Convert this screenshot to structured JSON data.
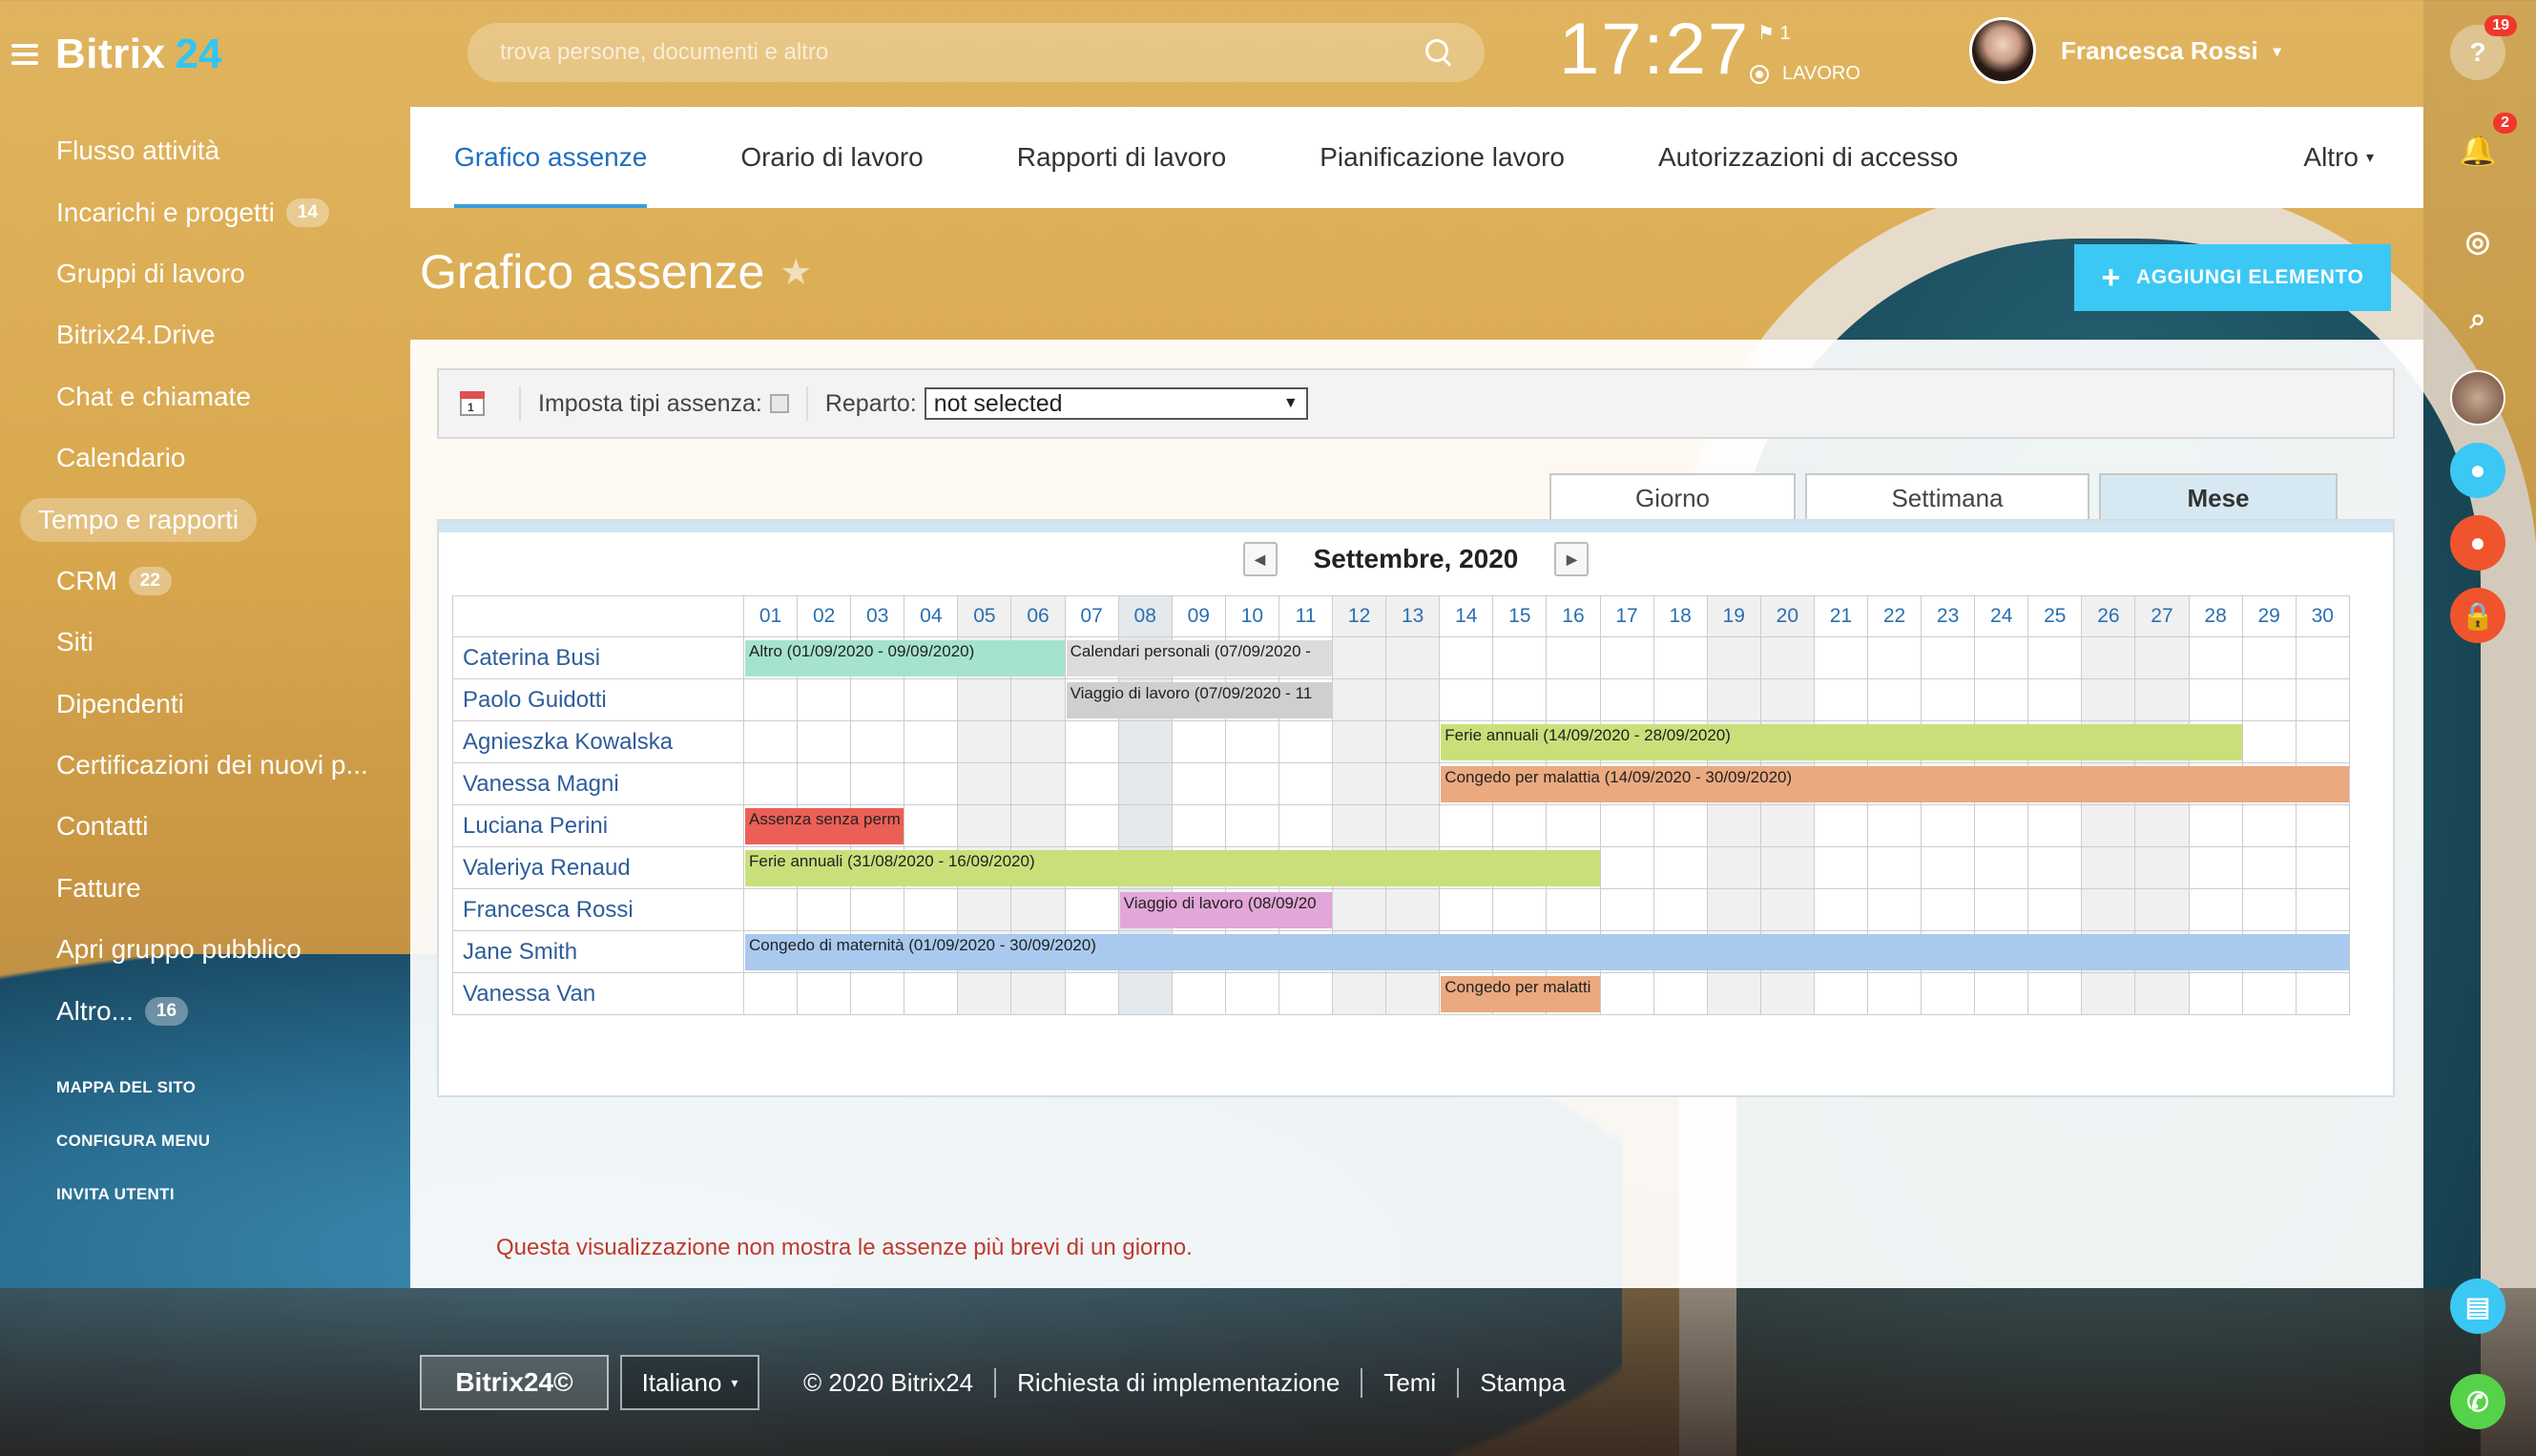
{
  "app": {
    "logo_text": "Bitrix",
    "logo_num": "24"
  },
  "search": {
    "placeholder": "trova persone, documenti e altro"
  },
  "clock": {
    "time": "17:27",
    "flag_count": "1",
    "status": "LAVORO"
  },
  "user": {
    "name": "Francesca Rossi"
  },
  "left_menu": {
    "items": [
      {
        "label": "Flusso attività"
      },
      {
        "label": "Incarichi e progetti",
        "counter": "14"
      },
      {
        "label": "Gruppi di lavoro"
      },
      {
        "label": "Bitrix24.Drive"
      },
      {
        "label": "Chat e chiamate"
      },
      {
        "label": "Calendario"
      },
      {
        "label": "Tempo e rapporti"
      },
      {
        "label": "CRM",
        "counter": "22"
      },
      {
        "label": "Siti"
      },
      {
        "label": "Dipendenti"
      },
      {
        "label": "Certificazioni dei nuovi p..."
      },
      {
        "label": "Contatti"
      },
      {
        "label": "Fatture"
      },
      {
        "label": "Apri gruppo pubblico"
      },
      {
        "label": "Altro... ",
        "counter": "16"
      }
    ],
    "small": [
      "MAPPA DEL SITO",
      "CONFIGURA MENU",
      "INVITA UTENTI"
    ]
  },
  "right_bar": {
    "help_badge": "19",
    "notif_badge": "2"
  },
  "top_nav": {
    "tabs": [
      "Grafico assenze",
      "Orario di lavoro",
      "Rapporti di lavoro",
      "Pianificazione lavoro",
      "Autorizzazioni di accesso"
    ],
    "more": "Altro"
  },
  "page": {
    "title": "Grafico assenze",
    "add_button": "AGGIUNGI ELEMENTO"
  },
  "filter": {
    "types_label": "Imposta tipi assenza:",
    "dept_label": "Reparto:",
    "dept_value": "not selected"
  },
  "view_tabs": [
    "Giorno",
    "Settimana",
    "Mese"
  ],
  "calendar": {
    "month": "Settembre, 2020",
    "days": [
      "01",
      "02",
      "03",
      "04",
      "05",
      "06",
      "07",
      "08",
      "09",
      "10",
      "11",
      "12",
      "13",
      "14",
      "15",
      "16",
      "17",
      "18",
      "19",
      "20",
      "21",
      "22",
      "23",
      "24",
      "25",
      "26",
      "27",
      "28",
      "29",
      "30"
    ],
    "employees": [
      "Caterina Busi",
      "Paolo Guidotti",
      "Agnieszka Kowalska",
      "Vanessa Magni",
      "Luciana Perini",
      "Valeriya Renaud",
      "Francesca Rossi",
      "Jane Smith",
      "Vanessa Van"
    ],
    "absences": [
      {
        "row": 0,
        "start": 1,
        "end": 6,
        "label": "Altro (01/09/2020 - 09/09/2020)",
        "color": "#a6e3cf"
      },
      {
        "row": 0,
        "start": 7,
        "end": 11,
        "label": "Calendari personali (07/09/2020 -",
        "color": "#dcdcdc"
      },
      {
        "row": 1,
        "start": 7,
        "end": 11,
        "label": "Viaggio di lavoro (07/09/2020 - 11",
        "color": "#cfcfcf"
      },
      {
        "row": 2,
        "start": 14,
        "end": 28,
        "label": "Ferie annuali (14/09/2020 - 28/09/2020)",
        "color": "#c9e07a"
      },
      {
        "row": 3,
        "start": 14,
        "end": 30,
        "label": "Congedo per malattia (14/09/2020 - 30/09/2020)",
        "color": "#eba97f"
      },
      {
        "row": 4,
        "start": 1,
        "end": 3,
        "label": "Assenza senza perm",
        "color": "#ec5f56"
      },
      {
        "row": 5,
        "start": 1,
        "end": 16,
        "label": "Ferie annuali (31/08/2020 - 16/09/2020)",
        "color": "#c9e07a"
      },
      {
        "row": 6,
        "start": 8,
        "end": 11,
        "label": "Viaggio di lavoro (08/09/20",
        "color": "#e3a6d8"
      },
      {
        "row": 7,
        "start": 1,
        "end": 30,
        "label": "Congedo di maternità (01/09/2020 - 30/09/2020)",
        "color": "#a9c9ef"
      },
      {
        "row": 8,
        "start": 14,
        "end": 16,
        "label": "Congedo per malatti",
        "color": "#eba97f"
      }
    ],
    "weekend_days": [
      5,
      6,
      12,
      13,
      19,
      20,
      26,
      27
    ],
    "today": 8,
    "note": "Questa visualizzazione non mostra le assenze più brevi di un giorno."
  },
  "footer": {
    "logo": "Bitrix24©",
    "lang": "Italiano",
    "links": [
      "© 2020 Bitrix24",
      "Richiesta di implementazione",
      "Temi",
      "Stampa"
    ]
  }
}
